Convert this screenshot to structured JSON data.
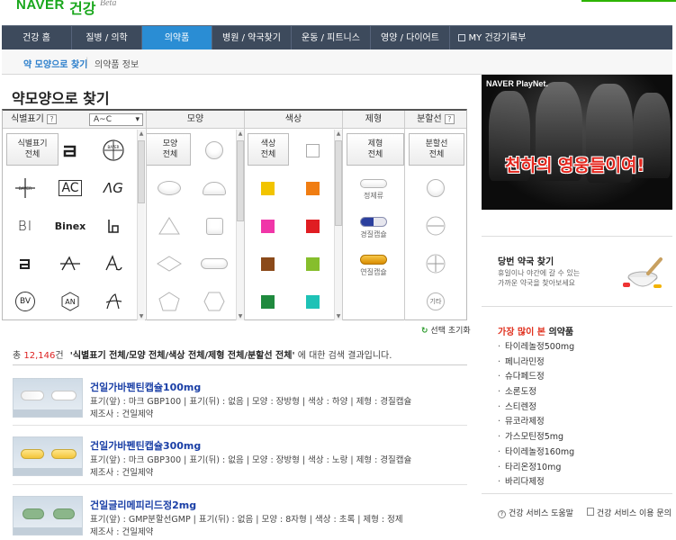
{
  "logo": {
    "naver": "NAVER",
    "health": "건강",
    "beta": "Beta"
  },
  "gnb": [
    {
      "label": "건강 홈"
    },
    {
      "label": "질병 / 의학"
    },
    {
      "label": "의약품",
      "active": true
    },
    {
      "label": "병원 / 약국찾기"
    },
    {
      "label": "운동 / 피트니스"
    },
    {
      "label": "영양 / 다이어트"
    },
    {
      "label": "MY 건강기록부"
    }
  ],
  "sub_nav": {
    "active": "약 모양으로 찾기",
    "other": "의약품 정보"
  },
  "page_title": "약모양으로 찾기",
  "grid": {
    "headers": {
      "mark": "식별표기",
      "range": "A~C",
      "shape": "모양",
      "color": "색상",
      "form": "제형",
      "split": "분할선"
    },
    "all_buttons": {
      "mark": [
        "식별표기",
        "전체"
      ],
      "shape": [
        "모양",
        "전체"
      ],
      "color": [
        "색상",
        "전체"
      ],
      "form": [
        "제형",
        "전체"
      ],
      "split": [
        "분할선",
        "전체"
      ]
    },
    "marks": [
      "a-logo",
      "BAYER",
      "BAYER",
      "AC",
      "AG",
      "BI",
      "Binex",
      "Bi",
      "a",
      "A-dash",
      "A-swirl",
      "BV",
      "AN",
      "A-script"
    ],
    "mark_text": {
      "ac": "AC",
      "ag": "ΛG",
      "bi": "BI",
      "binex": "Binex",
      "bv": "BV",
      "an": "AN"
    },
    "colors": [
      "#ffffff",
      "#f2c400",
      "#f07d12",
      "#f036a8",
      "#e01d22",
      "#8b4a1a",
      "#86be2c",
      "#1f8a3e",
      "#1ec2b6"
    ],
    "forms": [
      "정제류",
      "경질캡슐",
      "연질캡슐"
    ],
    "split_other": "기타"
  },
  "reset_label": "선택 초기화",
  "count": {
    "prefix": "총",
    "number": "12,146",
    "unit": "건",
    "query": "'식별표기 전체/모양 전체/색상 전체/제형 전체/분할선 전체'",
    "suffix": "에 대한 검색 결과입니다."
  },
  "results": [
    {
      "name": "건일가바펜틴캡슐100mg",
      "details": "표기(앞) : 마크 GBP100  |  표기(뒤) : 없음  |  모양 : 장방형  |  색상 : 하양  |  제형 : 경질캡슐",
      "maker": "제조사 : 건일제약"
    },
    {
      "name": "건일가바펜틴캡슐300mg",
      "details": "표기(앞) : 마크 GBP300  |  표기(뒤) : 없음  |  모양 : 장방형  |  색상 : 노랑  |  제형 : 경질캡슐",
      "maker": "제조사 : 건일제약"
    },
    {
      "name": "건일글리메피리드정2mg",
      "details": "표기(앞) : GMP분할선GMP  |  표기(뒤) : 없음  |  모양 : 8자형  |  색상 : 초록  |  제형 : 정제",
      "maker": "제조사 : 건일제약"
    }
  ],
  "ad": {
    "brand": "NAVER PlayNet.",
    "slogan": "천하의 영웅들이여!"
  },
  "pharmacy": {
    "title": "당번 약국 찾기",
    "desc": "휴일이나 야간에 갈 수 있는 가까운 약국을 찾아보세요"
  },
  "top_viewed": {
    "title_red": "가장 많이 본",
    "title_rest": " 의약품",
    "items": [
      "타이레놀정500mg",
      "페니라민정",
      "슈다페드정",
      "소론도정",
      "스티렌정",
      "뮤코라제정",
      "가스모틴정5mg",
      "타이레놀정160mg",
      "타리온정10mg",
      "바리다제정"
    ]
  },
  "footer": {
    "help": "건강 서비스 도움말",
    "terms": "건강 서비스 이용 문의"
  },
  "colors": {
    "green": "#19a71c",
    "nav_bg": "#3d4a5c",
    "nav_active": "#2a8dd4",
    "link_blue": "#1a3fa6",
    "accent_red": "#e0301e"
  }
}
